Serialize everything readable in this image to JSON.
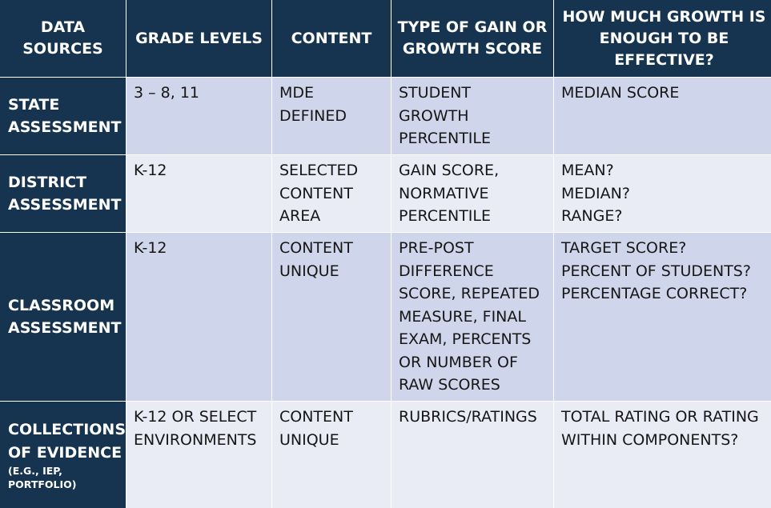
{
  "headers": [
    "DATA SOURCES",
    "GRADE LEVELS",
    "CONTENT",
    "TYPE OF GAIN OR GROWTH SCORE",
    "HOW MUCH GROWTH IS ENOUGH TO BE EFFECTIVE?"
  ],
  "rows": [
    {
      "source": [
        "STATE",
        "ASSESSMENT"
      ],
      "grades": [
        "3 – 8, 11"
      ],
      "content": [
        "MDE",
        "DEFINED"
      ],
      "type": [
        "STUDENT",
        "GROWTH",
        "PERCENTILE"
      ],
      "growth": [
        "MEDIAN SCORE"
      ]
    },
    {
      "source": [
        "DISTRICT",
        "ASSESSMENT"
      ],
      "grades": [
        "K-12"
      ],
      "content": [
        "SELECTED",
        "CONTENT",
        "AREA"
      ],
      "type": [
        "GAIN SCORE,",
        "NORMATIVE",
        "PERCENTILE"
      ],
      "growth": [
        "MEAN?",
        "MEDIAN?",
        "RANGE?"
      ]
    },
    {
      "source": [
        "CLASSROOM",
        "ASSESSMENT"
      ],
      "grades": [
        "K-12"
      ],
      "content": [
        "CONTENT",
        "UNIQUE"
      ],
      "type": [
        "PRE-POST",
        "DIFFERENCE",
        "SCORE, REPEATED",
        "MEASURE, FINAL",
        "EXAM, PERCENTS",
        "OR NUMBER OF",
        "RAW SCORES"
      ],
      "growth": [
        "TARGET SCORE?",
        "PERCENT OF STUDENTS?",
        "PERCENTAGE CORRECT?"
      ]
    },
    {
      "source": [
        "COLLECTIONS",
        "OF EVIDENCE"
      ],
      "source_note": [
        "(E.G., IEP,",
        "PORTFOLIO)"
      ],
      "grades": [
        "K-12 OR SELECT",
        "ENVIRONMENTS"
      ],
      "content": [
        "CONTENT",
        "UNIQUE"
      ],
      "type": [
        "RUBRICS/RATINGS"
      ],
      "growth": [
        "TOTAL RATING OR RATING",
        "WITHIN COMPONENTS?"
      ]
    }
  ],
  "colors": {
    "header_bg": "#16344f",
    "row_dark": "#cfd5ea",
    "row_light": "#e9ebf5",
    "header_text": "#ffffff"
  }
}
